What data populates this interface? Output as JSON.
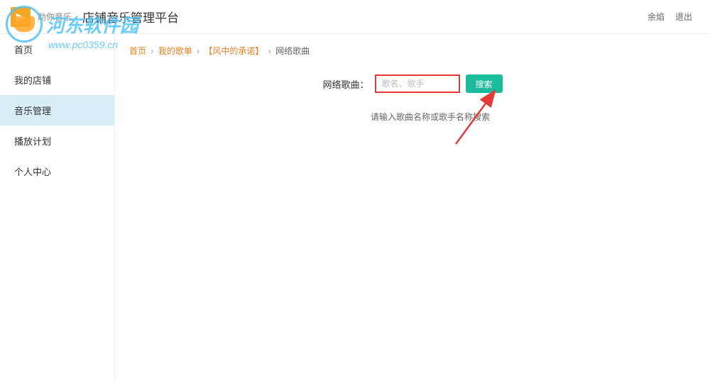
{
  "header": {
    "brand_small": "助你音乐",
    "title": "店铺音乐管理平台",
    "user": "余焰",
    "logout": "退出"
  },
  "sidebar": {
    "items": [
      {
        "label": "首页"
      },
      {
        "label": "我的店铺"
      },
      {
        "label": "音乐管理"
      },
      {
        "label": "播放计划"
      },
      {
        "label": "个人中心"
      }
    ]
  },
  "breadcrumb": {
    "home": "首页",
    "playlist": "我的歌单",
    "album": "【风中的承诺】",
    "current": "网络歌曲"
  },
  "search": {
    "label": "网络歌曲：",
    "placeholder": "歌名、歌手",
    "button": "搜索"
  },
  "hint": "请输入歌曲名称或歌手名称搜索",
  "watermark": {
    "text": "河东软件园",
    "url": "www.pc0359.cn"
  }
}
